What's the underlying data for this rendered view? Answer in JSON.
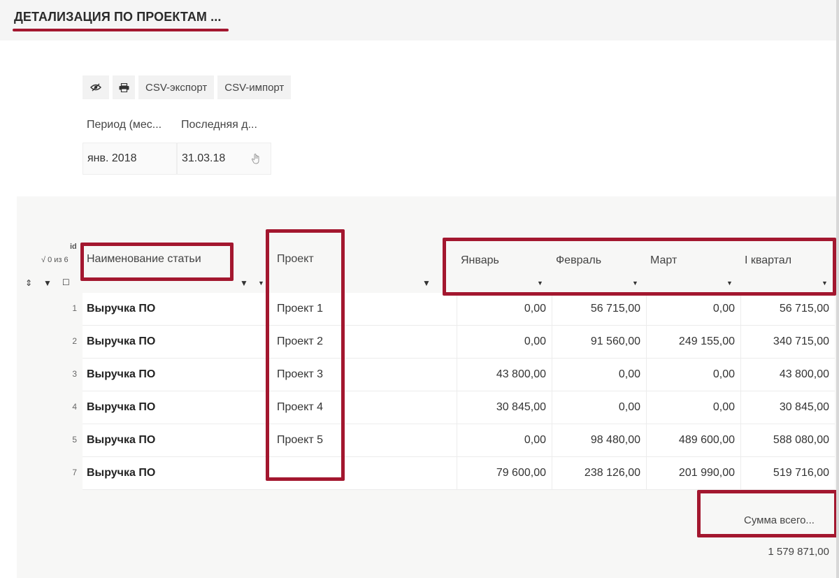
{
  "page_title": "ДЕТАЛИЗАЦИЯ ПО ПРОЕКТАМ ...",
  "toolbar": {
    "visibility_icon": "eye-slash-icon",
    "print_icon": "printer-icon",
    "csv_export_label": "CSV-экспорт",
    "csv_import_label": "CSV-импорт"
  },
  "params": {
    "period_label": "Период (мес...",
    "period_value": "янв. 2018",
    "last_date_label": "Последняя д...",
    "last_date_value": "31.03.18",
    "clear_icon": "hand-pointer-icon"
  },
  "grid": {
    "id_header": "id",
    "selection_count": "√ 0 из 6",
    "columns": {
      "name": "Наименование статьи",
      "project": "Проект",
      "jan": "Январь",
      "feb": "Февраль",
      "mar": "Март",
      "q1": "I квартал"
    },
    "rows": [
      {
        "id": "1",
        "name": "Выручка ПО",
        "project": "Проект 1",
        "jan": "0,00",
        "feb": "56 715,00",
        "mar": "0,00",
        "q1": "56 715,00"
      },
      {
        "id": "2",
        "name": "Выручка ПО",
        "project": "Проект 2",
        "jan": "0,00",
        "feb": "91 560,00",
        "mar": "249 155,00",
        "q1": "340 715,00"
      },
      {
        "id": "3",
        "name": "Выручка ПО",
        "project": "Проект 3",
        "jan": "43 800,00",
        "feb": "0,00",
        "mar": "0,00",
        "q1": "43 800,00"
      },
      {
        "id": "4",
        "name": "Выручка ПО",
        "project": "Проект 4",
        "jan": "30 845,00",
        "feb": "0,00",
        "mar": "0,00",
        "q1": "30 845,00"
      },
      {
        "id": "5",
        "name": "Выручка ПО",
        "project": "Проект 5",
        "jan": "0,00",
        "feb": "98 480,00",
        "mar": "489 600,00",
        "q1": "588 080,00"
      },
      {
        "id": "7",
        "name": "Выручка ПО",
        "project": "",
        "jan": "79 600,00",
        "feb": "238 126,00",
        "mar": "201 990,00",
        "q1": "519 716,00"
      }
    ],
    "total_label": "Сумма всего...",
    "total_value": "1 579 871,00"
  },
  "colors": {
    "accent": "#a3172f",
    "grid_background": "#f7f7f6"
  }
}
